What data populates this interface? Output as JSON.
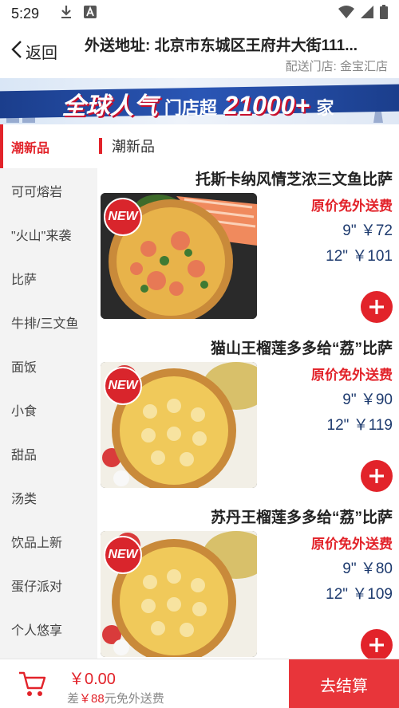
{
  "status_bar": {
    "time": "5:29",
    "icons_left": [
      "download-icon",
      "a-icon"
    ],
    "icons_right": [
      "wifi-icon",
      "signal-icon",
      "battery-icon"
    ]
  },
  "header": {
    "back_label": "返回",
    "address": "外送地址: 北京市东城区王府井大街111...",
    "store": "配送门店: 金宝汇店"
  },
  "banner": {
    "big_text": "全球人气",
    "small_text": "门店超",
    "number": "21000+",
    "suffix": "家"
  },
  "sidebar": {
    "categories": [
      {
        "label": "潮新品",
        "active": true
      },
      {
        "label": "可可熔岩",
        "active": false
      },
      {
        "label": "\"火山\"来袭",
        "active": false
      },
      {
        "label": "比萨",
        "active": false
      },
      {
        "label": "牛排/三文鱼",
        "active": false
      },
      {
        "label": "面饭",
        "active": false
      },
      {
        "label": "小食",
        "active": false
      },
      {
        "label": "甜品",
        "active": false
      },
      {
        "label": "汤类",
        "active": false
      },
      {
        "label": "饮品上新",
        "active": false
      },
      {
        "label": "蛋仔派对",
        "active": false
      },
      {
        "label": "个人悠享",
        "active": false
      }
    ]
  },
  "section": {
    "title": "潮新品"
  },
  "products": [
    {
      "name": "托斯卡纳风情芝浓三文鱼比萨",
      "badge": "NEW",
      "promo": "原价免外送费",
      "price_9": "9\" ￥72",
      "price_12": "12\" ￥101"
    },
    {
      "name": "猫山王榴莲多多给“荔”比萨",
      "badge": "NEW",
      "promo": "原价免外送费",
      "price_9": "9\" ￥90",
      "price_12": "12\" ￥119"
    },
    {
      "name": "苏丹王榴莲多多给“荔”比萨",
      "badge": "NEW",
      "promo": "原价免外送费",
      "price_9": "9\" ￥80",
      "price_12": "12\" ￥109"
    }
  ],
  "bottom_bar": {
    "total": "￥0.00",
    "note_prefix": "差",
    "note_amount": "￥88",
    "note_suffix": "元免外送费",
    "checkout_label": "去结算"
  },
  "colors": {
    "accent": "#e2232a",
    "price": "#1d3a6e",
    "sidebar_bg": "#f3f3f3",
    "banner_blue": "#1b3e8c"
  }
}
